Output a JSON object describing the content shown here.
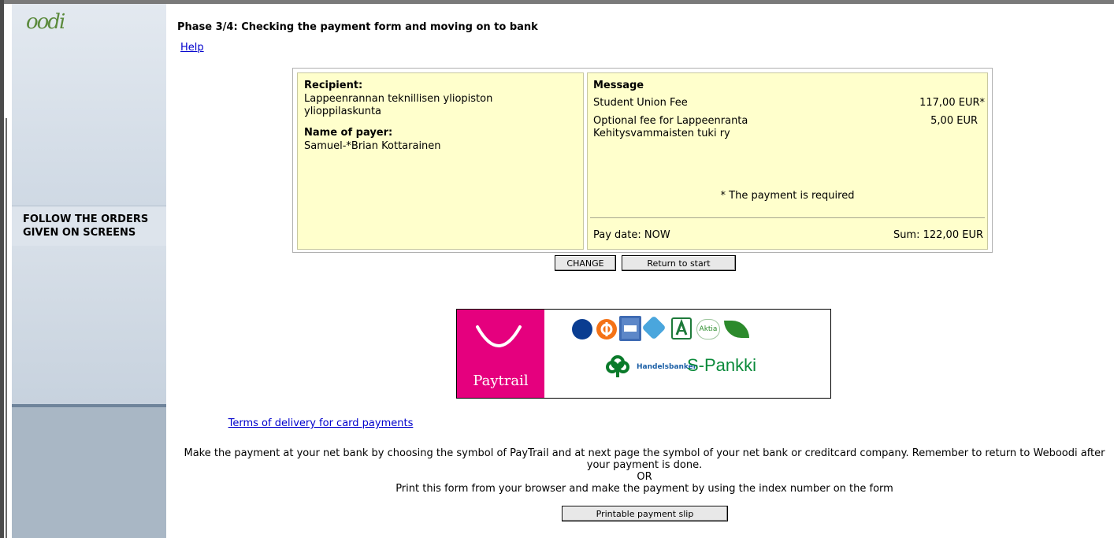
{
  "sidebar": {
    "logo_text": "oodi",
    "orders_text": "FOLLOW THE ORDERS GIVEN ON SCREENS"
  },
  "header": {
    "phase_title": "Phase 3/4: Checking the payment form and moving on to bank",
    "help_link": "Help"
  },
  "payment": {
    "recipient_label": "Recipient:",
    "recipient": "Lappeenrannan teknillisen yliopiston ylioppilaskunta",
    "payer_label": "Name of payer:",
    "payer": "Samuel-*Brian Kottarainen",
    "message_label": "Message",
    "items": [
      {
        "name": "Student Union Fee",
        "amount": "117,00 EUR*"
      },
      {
        "name": "Optional fee for Lappeenranta Kehitysvammaisten tuki ry",
        "amount": "5,00 EUR"
      }
    ],
    "required_note": "* The payment is required",
    "pay_date": "Pay date: NOW",
    "sum": "Sum: 122,00 EUR"
  },
  "buttons": {
    "change": "CHANGE",
    "return_to_start": "Return to start",
    "printable_slip": "Printable payment slip"
  },
  "paytrail": {
    "brand": "Paytrail",
    "banks": [
      "Nordea",
      "OP",
      "Danske Bank",
      "Säästöpankki",
      "POP Pankki",
      "Aktia",
      "Ålandsbanken",
      "Handelsbanken",
      "S-Pankki"
    ],
    "aktia_label": "Aktia",
    "handelsbanken_label": "Handelsbanken",
    "spankki_label": "S-Pankki",
    "brand_color": "#e5007e"
  },
  "footer": {
    "terms_link": "Terms of delivery for card payments",
    "instruction_1": "Make the payment at your net bank by choosing the symbol of PayTrail and at next page the symbol of your net bank or creditcard company. Remember to return to Weboodi after your payment is done.",
    "or": "OR",
    "instruction_2": "Print this form from your browser and make the payment by using the index number on the form"
  }
}
